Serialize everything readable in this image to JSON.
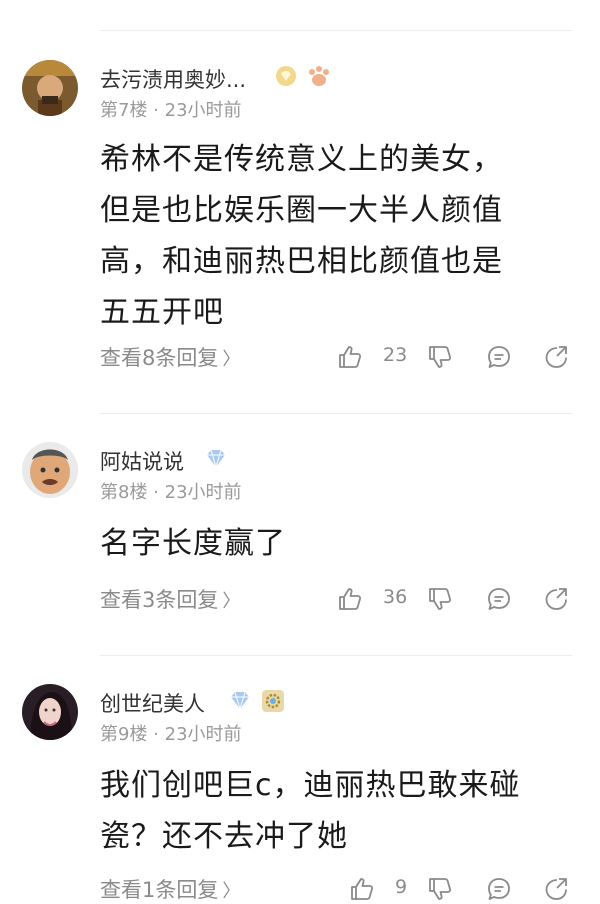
{
  "comments": [
    {
      "username": "去污渍用奥妙...",
      "meta": "第7楼 · 23小时前",
      "text_lines": [
        "希林不是传统意义上的美女，",
        "但是也比娱乐圈一大半人颜值",
        "高，和迪丽热巴相比颜值也是",
        "五五开吧"
      ],
      "replies_label": "查看8条回复",
      "like_count": "23",
      "badges": [
        "gold-gem-badge",
        "paw-badge"
      ]
    },
    {
      "username": "阿姑说说",
      "meta": "第8楼 · 23小时前",
      "text_lines": [
        "名字长度赢了"
      ],
      "replies_label": "查看3条回复",
      "like_count": "36",
      "badges": [
        "blue-diamond-badge"
      ]
    },
    {
      "username": "创世纪美人",
      "meta": "第9楼 · 23小时前",
      "text_lines": [
        "我们创吧巨c，迪丽热巴敢来碰",
        "瓷？还不去冲了她"
      ],
      "replies_label": "查看1条回复",
      "like_count": "9",
      "badges": [
        "blue-diamond-badge",
        "gear-badge"
      ]
    }
  ],
  "icons": [
    "thumbs-up-icon",
    "thumbs-down-icon",
    "reply-icon",
    "share-icon"
  ],
  "colors": {
    "text": "#1a1a1a",
    "meta": "#9a9a9a",
    "icon": "#8a8a8a",
    "gold": "#e8c25a",
    "blue": "#8fb8ea",
    "paw": "#e89a6a"
  }
}
